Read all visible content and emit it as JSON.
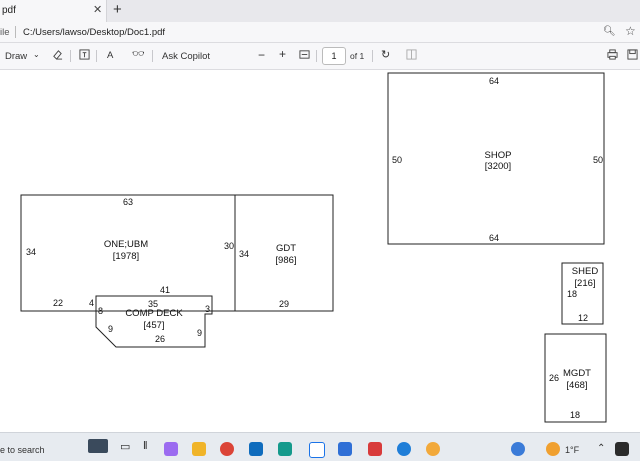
{
  "browser": {
    "tab_title": "pdf",
    "close_glyph": "✕",
    "new_tab_glyph": "+",
    "address_label": "ile",
    "address_path": "C:/Users/lawso/Desktop/Doc1.pdf",
    "zoom_icon": "zoom-icon",
    "favorite_icon": "star-icon"
  },
  "toolbar": {
    "draw_label": "Draw",
    "copilot_label": "Ask Copilot",
    "minus": "−",
    "plus": "+",
    "page_number": "1",
    "page_total": "of 1",
    "read_aloud": "A",
    "translate": "ꭤ"
  },
  "drawing": {
    "shop": {
      "name": "SHOP",
      "area": "[3200]",
      "top": "64",
      "bottom": "64",
      "left": "50",
      "right": "50"
    },
    "one_ubm": {
      "name": "ONE;UBM",
      "area": "[1978]",
      "top": "63",
      "left": "34",
      "right": "30",
      "bottom_left": "22",
      "small": "4",
      "mid": "41"
    },
    "gdt": {
      "name": "GDT",
      "area": "[986]",
      "left": "34",
      "bottom": "29"
    },
    "comp_deck": {
      "name": "COMP DECK",
      "area": "[457]",
      "top": "35",
      "bottom": "26",
      "left_a": "8",
      "left_b": "9",
      "right_a": "3",
      "right_b": "9"
    },
    "shed": {
      "name": "SHED",
      "area": "[216]",
      "left": "18",
      "bottom": "12"
    },
    "mgdt": {
      "name": "MGDT",
      "area": "[468]",
      "left": "26",
      "bottom": "18"
    }
  },
  "taskbar": {
    "search_text": "e to search",
    "weather": "1°F",
    "colors": {
      "edge": "#1f7ed8",
      "chrome": "#db4437",
      "files": "#f0b429",
      "store": "#2f6fd6",
      "copilot": "#7b5cf0"
    }
  }
}
